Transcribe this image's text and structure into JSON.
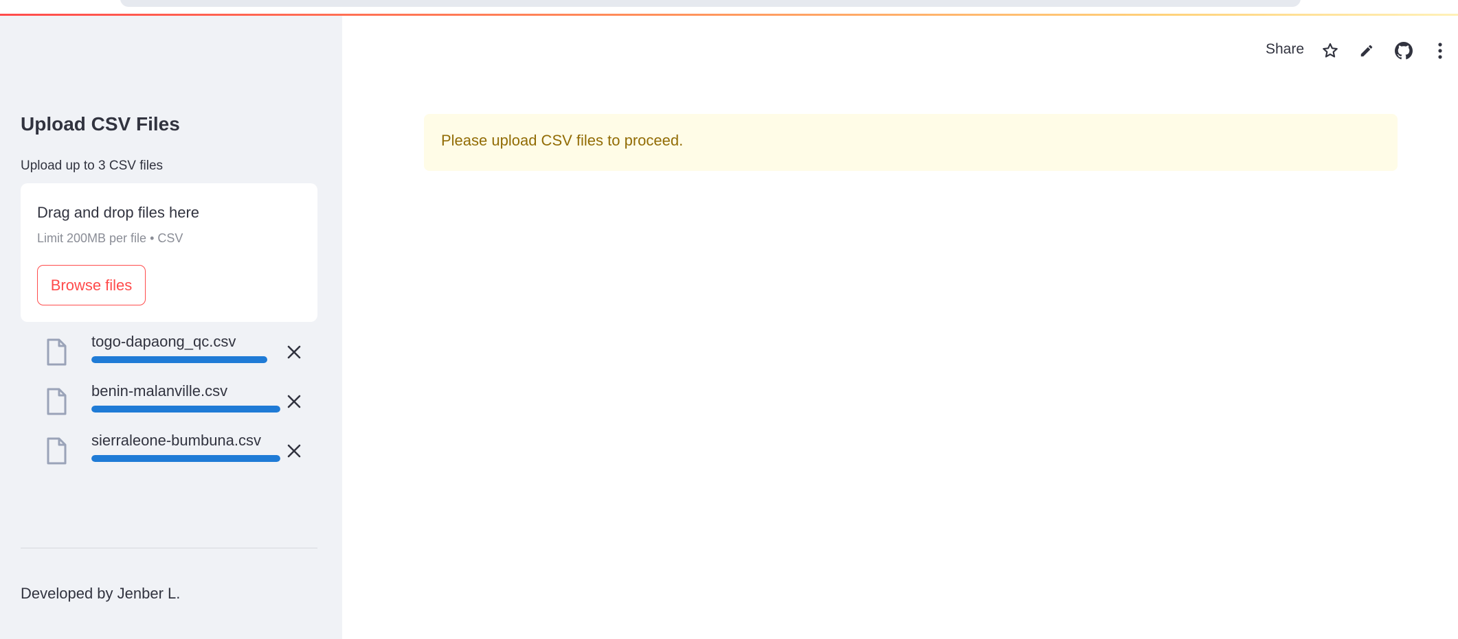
{
  "sidebar": {
    "title": "Upload CSV Files",
    "uploader_label": "Upload up to 3 CSV files",
    "dropzone": {
      "title": "Drag and drop files here",
      "limit_text": "Limit 200MB per file • CSV",
      "browse_label": "Browse files"
    },
    "files": [
      {
        "name": "togo-dapaong_qc.csv",
        "progress": 0.93,
        "icon": "file-icon",
        "remove_icon": "close-icon"
      },
      {
        "name": "benin-malanville.csv",
        "progress": 1.0,
        "icon": "file-icon",
        "remove_icon": "close-icon"
      },
      {
        "name": "sierraleone-bumbuna.csv",
        "progress": 1.0,
        "icon": "file-icon",
        "remove_icon": "close-icon"
      }
    ],
    "footer": "Developed by Jenber L."
  },
  "toolbar": {
    "share_label": "Share",
    "icons": [
      "star-icon",
      "pencil-icon",
      "github-icon",
      "more-vertical-icon"
    ]
  },
  "main": {
    "alert_text": "Please upload CSV files to proceed."
  },
  "colors": {
    "accent": "#ff4b4b",
    "progress": "#1f7bd6",
    "sidebar_bg": "#f0f2f6",
    "alert_bg": "#fffce7",
    "alert_text": "#926c05"
  }
}
